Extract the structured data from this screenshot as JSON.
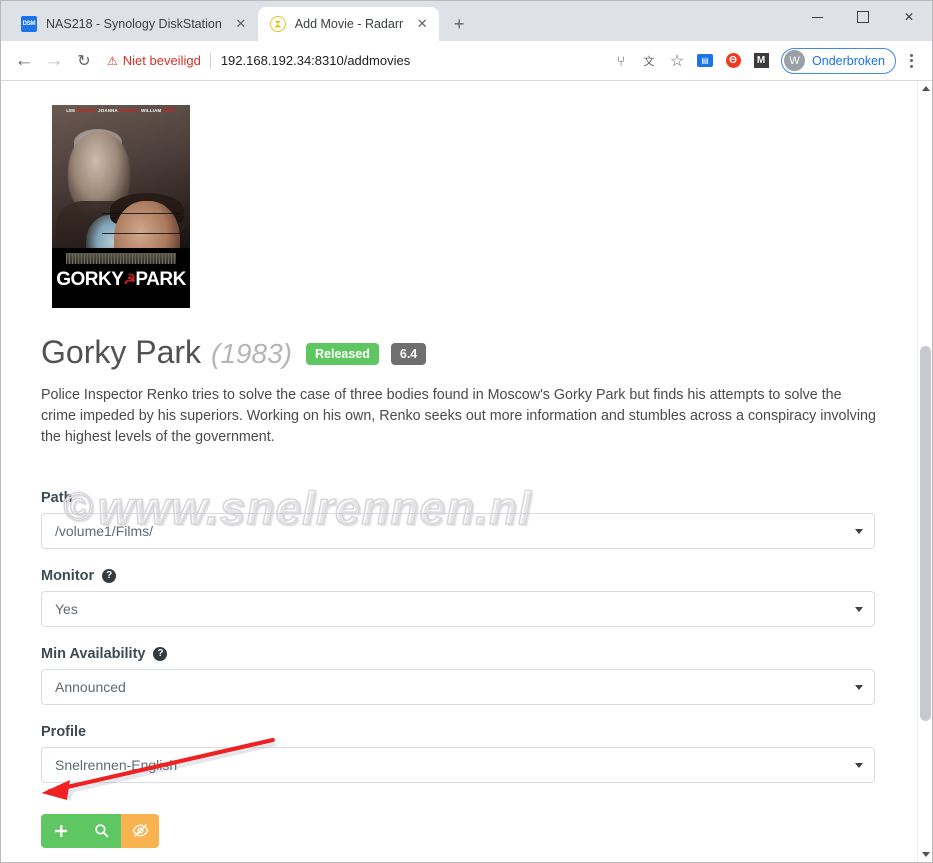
{
  "browser": {
    "tabs": [
      {
        "title": "NAS218 - Synology DiskStation",
        "favicon": "dsm-icon",
        "active": false,
        "close_label": "✕"
      },
      {
        "title": "Add Movie - Radarr",
        "favicon": "radarr-icon",
        "active": true,
        "close_label": "✕"
      }
    ],
    "new_tab_label": "+",
    "window_controls": {
      "minimize": "",
      "maximize": "",
      "close": "✕"
    },
    "nav": {
      "back": "←",
      "forward": "→",
      "reload": "↻"
    },
    "omnibox": {
      "warning_icon": "⚠",
      "warning_text": "Niet beveiligd",
      "url": "192.168.192.34:8310/addmovies"
    },
    "toolbar_icons": [
      {
        "name": "password-key-icon",
        "glyph": "⑂"
      },
      {
        "name": "translate-icon",
        "glyph": "文"
      },
      {
        "name": "bookmark-star-icon",
        "glyph": "☆"
      },
      {
        "name": "extension-blue-icon",
        "glyph": "▤"
      },
      {
        "name": "extension-orange-icon",
        "glyph": "Θ"
      },
      {
        "name": "extension-dark-icon",
        "glyph": "M"
      }
    ],
    "profile": {
      "initial": "W",
      "label": "Onderbroken"
    },
    "menu_label": "⋮"
  },
  "movie": {
    "poster": {
      "actors_line": [
        {
          "text": "LEE ",
          "red": false
        },
        {
          "text": "MARVIN",
          "red": true
        },
        {
          "text": "  JOANNA ",
          "red": false
        },
        {
          "text": "PACULA",
          "red": true
        },
        {
          "text": "  WILLIAM ",
          "red": false
        },
        {
          "text": "HURT",
          "red": true
        }
      ],
      "title_left": "GORKY",
      "title_right": "PARK",
      "sickle_glyph": "☭"
    },
    "title": "Gorky Park",
    "year": "(1983)",
    "status_badge": "Released",
    "rating_badge": "6.4",
    "overview": "Police Inspector Renko tries to solve the case of three bodies found in Moscow's Gorky Park but finds his attempts to solve the crime impeded by his superiors. Working on his own, Renko seeks out more information and stumbles across a conspiracy involving the highest levels of the government."
  },
  "watermark": {
    "copyright": "©",
    "text": "www.snelrennen.nl"
  },
  "form": {
    "fields": [
      {
        "label": "Path",
        "value": "/volume1/Films/",
        "help": false,
        "name": "path"
      },
      {
        "label": "Monitor",
        "value": "Yes",
        "help": true,
        "help_glyph": "?",
        "name": "monitor"
      },
      {
        "label": "Min Availability",
        "value": "Announced",
        "help": true,
        "help_glyph": "?",
        "name": "min-availability"
      },
      {
        "label": "Profile",
        "value": "Snelrennen-English",
        "help": false,
        "name": "profile"
      }
    ]
  },
  "actions": {
    "add": {
      "glyph": "➕",
      "name": "add-movie-button"
    },
    "search": {
      "glyph": "⚲",
      "name": "add-and-search-button"
    },
    "exclude": {
      "glyph": "ʘ",
      "name": "exclude-movie-button"
    }
  },
  "colors": {
    "accent_green": "#5fc761",
    "accent_orange": "#f8b24f",
    "rating_grey": "#6f6f6f",
    "warning_red": "#d93025",
    "annotation_red": "#ee2222",
    "chrome_tabstrip": "#dee1e6"
  },
  "scrollbar": {
    "up_arrow": "▲",
    "down_arrow": "▼"
  }
}
